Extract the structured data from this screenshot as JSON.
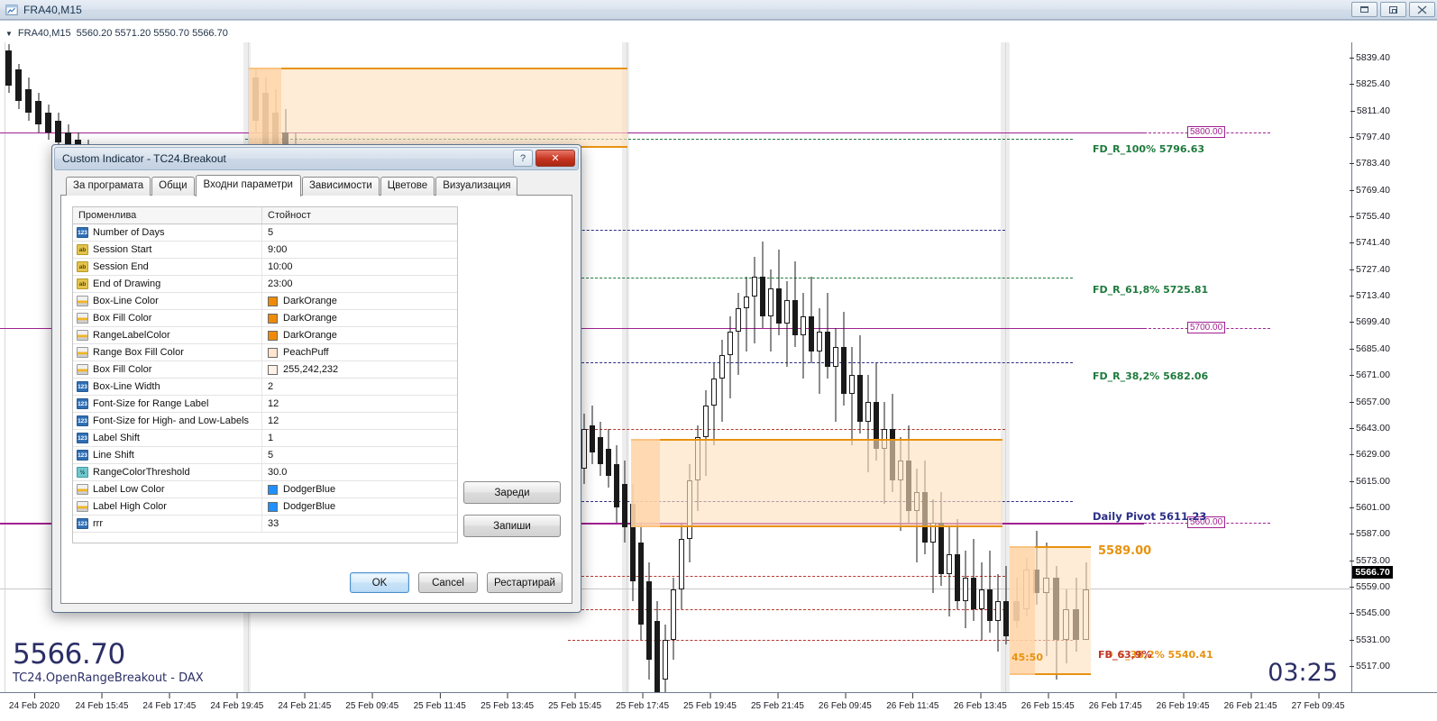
{
  "window": {
    "title": "FRA40,M15",
    "icon": "chart-window-icon",
    "controls": {
      "minimize": "minimize-icon",
      "restore": "restore-icon",
      "close": "close-icon"
    }
  },
  "chart": {
    "symbol_line": "FRA40,M15",
    "ohlc": "5560.20 5571.20 5550.70 5566.70",
    "open": "5560.20",
    "high": "5571.20",
    "low": "5550.70",
    "close": "5566.70",
    "big_price": "5566.70",
    "indicator_label": "TC24.OpenRangeBreakout - DAX",
    "clock": "03:25",
    "current_price_tag": "5566.70",
    "price_ticks": [
      "5839.40",
      "5825.40",
      "5811.40",
      "5797.40",
      "5783.40",
      "5769.40",
      "5755.40",
      "5741.40",
      "5727.40",
      "5713.40",
      "5699.40",
      "5685.40",
      "5671.00",
      "5657.00",
      "5643.00",
      "5629.00",
      "5615.00",
      "5601.00",
      "5587.00",
      "5573.00",
      "5559.00",
      "5545.00",
      "5531.00",
      "5517.00"
    ],
    "time_ticks": [
      "24 Feb 2020",
      "24 Feb 15:45",
      "24 Feb 17:45",
      "24 Feb 19:45",
      "24 Feb 21:45",
      "25 Feb 09:45",
      "25 Feb 11:45",
      "25 Feb 13:45",
      "25 Feb 15:45",
      "25 Feb 17:45",
      "25 Feb 19:45",
      "25 Feb 21:45",
      "26 Feb 09:45",
      "26 Feb 11:45",
      "26 Feb 13:45",
      "26 Feb 15:45",
      "26 Feb 17:45",
      "26 Feb 19:45",
      "26 Feb 21:45",
      "27 Feb 09:45"
    ],
    "annotations": [
      {
        "name": "fd-r-100",
        "text": "FD_R_100% 5796.63",
        "color": "#1f7a3d"
      },
      {
        "name": "fd-r-618",
        "text": "FD_R_61,8% 5725.81",
        "color": "#1f7a3d"
      },
      {
        "name": "fd-r-382",
        "text": "FD_R_38,2% 5682.06",
        "color": "#1f7a3d"
      },
      {
        "name": "daily-pivot",
        "text": "Daily Pivot  5611.23",
        "color": "#2b2f86"
      },
      {
        "name": "range-high",
        "text": "5589.00",
        "color": "#e8920f"
      },
      {
        "name": "range-time",
        "text": "45:50",
        "color": "#e8920f"
      },
      {
        "name": "fd-s-382",
        "text": "FD_S_38,2%  5540.41",
        "color": "#e8920f"
      },
      {
        "name": "fb-63",
        "text": "FB_63,9%",
        "color": "#c0392b"
      }
    ],
    "price_tags": [
      "5800.00",
      "5700.00",
      "5600.00"
    ]
  },
  "dialog": {
    "title": "Custom Indicator - TC24.Breakout",
    "help_glyph": "?",
    "close_glyph": "✕",
    "tabs": [
      {
        "label": "За програмата",
        "active": false
      },
      {
        "label": "Общи",
        "active": false
      },
      {
        "label": "Входни параметри",
        "active": true
      },
      {
        "label": "Зависимости",
        "active": false
      },
      {
        "label": "Цветове",
        "active": false
      },
      {
        "label": "Визуализация",
        "active": false
      }
    ],
    "grid": {
      "headers": [
        "Променлива",
        "Стойност"
      ],
      "rows": [
        {
          "icon": "number-type-icon",
          "type": "num",
          "name": "Number of Days",
          "value": "5"
        },
        {
          "icon": "string-type-icon",
          "type": "str",
          "name": "Session Start",
          "value": "9:00"
        },
        {
          "icon": "string-type-icon",
          "type": "str",
          "name": "Session End",
          "value": "10:00"
        },
        {
          "icon": "string-type-icon",
          "type": "str",
          "name": "End of Drawing",
          "value": "23:00"
        },
        {
          "icon": "color-type-icon",
          "type": "col",
          "name": "Box-Line Color",
          "value": "DarkOrange",
          "swatch": "#ef8a08"
        },
        {
          "icon": "color-type-icon",
          "type": "col",
          "name": "Box Fill Color",
          "value": "DarkOrange",
          "swatch": "#ef8a08"
        },
        {
          "icon": "color-type-icon",
          "type": "col",
          "name": "RangeLabelColor",
          "value": "DarkOrange",
          "swatch": "#ef8a08"
        },
        {
          "icon": "color-type-icon",
          "type": "col",
          "name": "Range Box Fill Color",
          "value": "PeachPuff",
          "swatch": "#ffe5cd"
        },
        {
          "icon": "color-type-icon",
          "type": "col",
          "name": "Box Fill Color",
          "value": "255,242,232",
          "swatch": "#fff2e8"
        },
        {
          "icon": "number-type-icon",
          "type": "num",
          "name": "Box-Line Width",
          "value": "2"
        },
        {
          "icon": "number-type-icon",
          "type": "num",
          "name": "Font-Size for Range Label",
          "value": "12"
        },
        {
          "icon": "number-type-icon",
          "type": "num",
          "name": "Font-Size for High- and Low-Labels",
          "value": "12"
        },
        {
          "icon": "number-type-icon",
          "type": "num",
          "name": "Label Shift",
          "value": "1"
        },
        {
          "icon": "number-type-icon",
          "type": "num",
          "name": "Line Shift",
          "value": "5"
        },
        {
          "icon": "double-type-icon",
          "type": "dbl",
          "name": "RangeColorThreshold",
          "value": "30.0"
        },
        {
          "icon": "color-type-icon",
          "type": "col",
          "name": "Label Low Color",
          "value": "DodgerBlue",
          "swatch": "#1e90ff"
        },
        {
          "icon": "color-type-icon",
          "type": "col",
          "name": "Label High Color",
          "value": "DodgerBlue",
          "swatch": "#1e90ff"
        },
        {
          "icon": "number-type-icon",
          "type": "num",
          "name": "rrr",
          "value": "33"
        }
      ]
    },
    "buttons": {
      "load": "Зареди",
      "save": "Запиши",
      "ok": "OK",
      "cancel": "Cancel",
      "restart": "Рестартирай"
    }
  }
}
